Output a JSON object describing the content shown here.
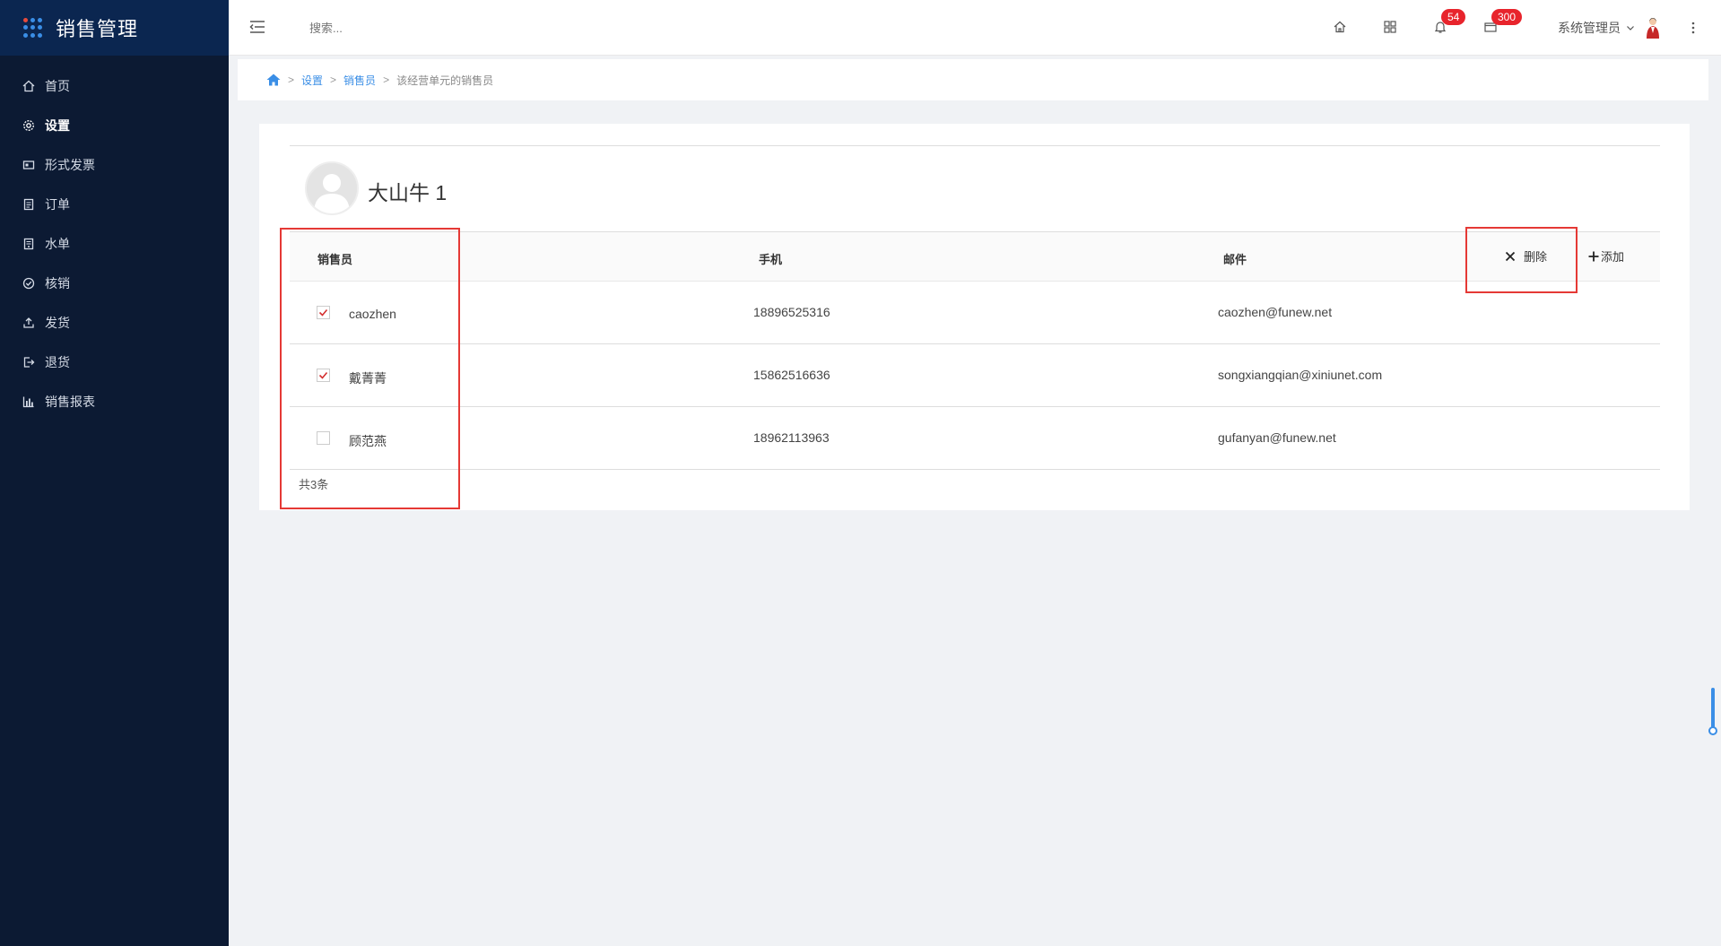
{
  "brand": {
    "title": "销售管理"
  },
  "sidebar": {
    "items": [
      {
        "label": "首页",
        "icon": "home-icon"
      },
      {
        "label": "设置",
        "icon": "gear-icon",
        "active": true
      },
      {
        "label": "形式发票",
        "icon": "invoice-icon"
      },
      {
        "label": "订单",
        "icon": "order-icon"
      },
      {
        "label": "水单",
        "icon": "receipt-icon"
      },
      {
        "label": "核销",
        "icon": "check-circle-icon"
      },
      {
        "label": "发货",
        "icon": "upload-icon"
      },
      {
        "label": "退货",
        "icon": "logout-icon"
      },
      {
        "label": "销售报表",
        "icon": "bar-chart-icon"
      }
    ]
  },
  "header": {
    "search_placeholder": "搜索...",
    "notification_count": "54",
    "message_count": "300",
    "user_name": "系统管理员"
  },
  "breadcrumb": {
    "items": [
      "设置",
      "销售员"
    ],
    "current": "该经营单元的销售员"
  },
  "unit": {
    "name": "大山牛 1"
  },
  "table": {
    "columns": {
      "name": "销售员",
      "phone": "手机",
      "email": "邮件"
    },
    "rows": [
      {
        "name": "caozhen",
        "phone": "18896525316",
        "email": "caozhen@funew.net",
        "checked": true
      },
      {
        "name": "戴菁菁",
        "phone": "15862516636",
        "email": "songxiangqian@xiniunet.com",
        "checked": true
      },
      {
        "name": "顾范燕",
        "phone": "18962113963",
        "email": "gufanyan@funew.net",
        "checked": false
      }
    ],
    "total": "共3条"
  },
  "actions": {
    "delete_label": "删除",
    "add_label": "添加"
  },
  "colors": {
    "sidebar_bg": "#0c1a33",
    "accent": "#3a8ee6",
    "highlight": "#e53935",
    "badge": "#e8242c"
  }
}
